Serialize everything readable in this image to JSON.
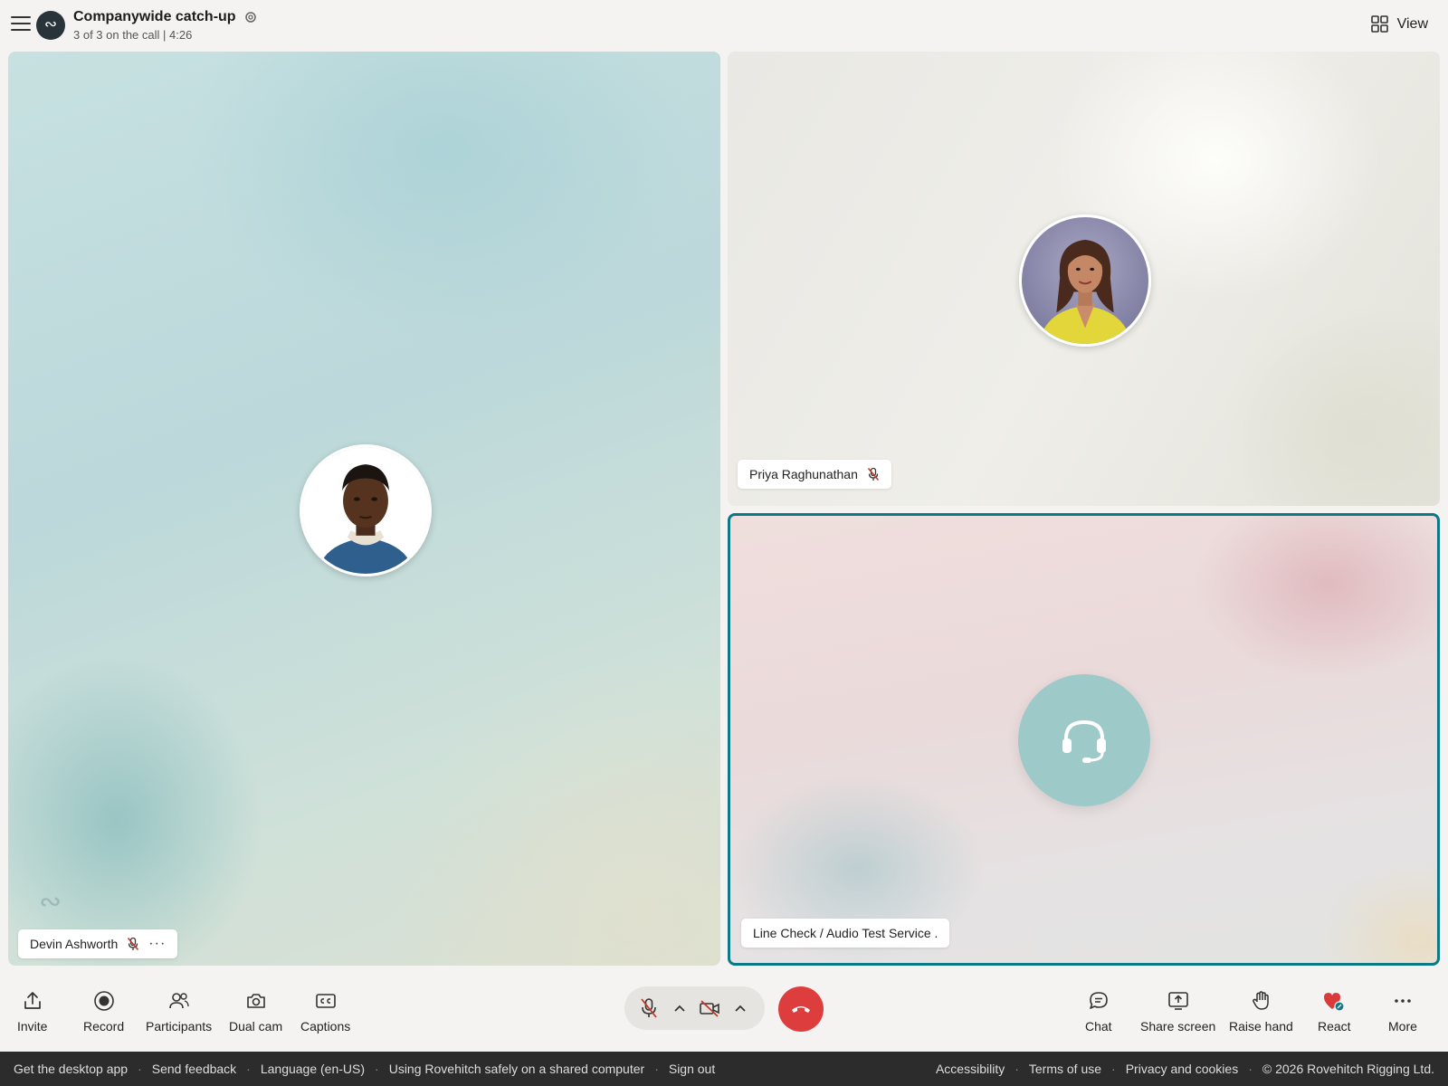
{
  "meeting": {
    "title": "Companywide catch-up",
    "status": "3 of 3 on the call | 4:26",
    "logo_glyph": "∾"
  },
  "header": {
    "view_label": "View"
  },
  "participants": [
    {
      "name": "Devin Ashworth",
      "muted": true
    },
    {
      "name": "Priya Raghunathan",
      "muted": true
    },
    {
      "name": "Line Check / Audio Test Service .",
      "active_speaker": true
    }
  ],
  "watermark_glyph": "∾",
  "more_dots": "···",
  "toolbar": {
    "left": [
      {
        "label": "Invite",
        "icon": "share-icon"
      },
      {
        "label": "Record",
        "icon": "record-icon"
      },
      {
        "label": "Participants",
        "icon": "people-icon"
      },
      {
        "label": "Dual cam",
        "icon": "camera-icon"
      },
      {
        "label": "Captions",
        "icon": "captions-icon"
      }
    ],
    "right": [
      {
        "label": "Chat",
        "icon": "chat-icon"
      },
      {
        "label": "Share screen",
        "icon": "share-screen-icon"
      },
      {
        "label": "Raise hand",
        "icon": "hand-icon"
      },
      {
        "label": "React",
        "icon": "heart-icon"
      },
      {
        "label": "More",
        "icon": "more-icon"
      }
    ]
  },
  "colors": {
    "accent": "#0c7a86",
    "hangup": "#dd3d3d",
    "muted_icon": "#c0392b",
    "footer_bg": "#2c2c2c"
  },
  "footer": {
    "left_links": [
      "Get the desktop app",
      "Send feedback",
      "Language (en-US)",
      "Using Rovehitch safely on a shared computer",
      "Sign out"
    ],
    "right_links": [
      "Accessibility",
      "Terms of use",
      "Privacy and cookies",
      "© 2026 Rovehitch Rigging Ltd."
    ],
    "separator": "·"
  }
}
